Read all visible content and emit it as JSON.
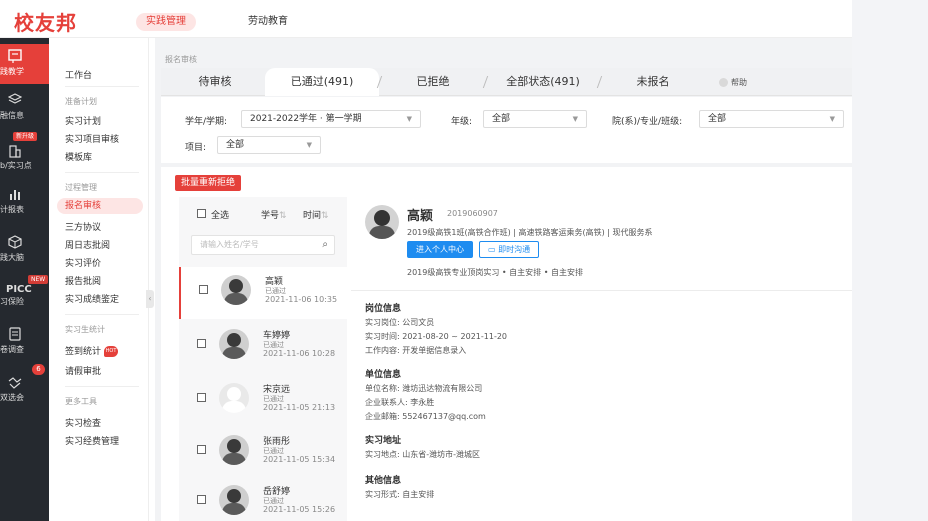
{
  "header": {
    "logo": "校友邦",
    "tabs": [
      {
        "label": "实践管理",
        "active": true
      },
      {
        "label": "劳动教育",
        "active": false
      }
    ]
  },
  "rail": {
    "items": [
      {
        "label": "践教学",
        "icon": "book-icon",
        "active": true
      },
      {
        "label": "融信息",
        "icon": "layers-icon",
        "active": false
      },
      {
        "label": "b/实习点",
        "icon": "building-icon",
        "active": false,
        "badge": "新升级"
      },
      {
        "label": "计报表",
        "icon": "bar-chart-icon",
        "active": false
      },
      {
        "label": "践大脑",
        "icon": "cube-icon",
        "active": false
      },
      {
        "label": "习保险",
        "icon": "picc-icon",
        "active": false,
        "badge": "NEW",
        "logo_text": "PICC"
      },
      {
        "label": "卷调查",
        "icon": "survey-icon",
        "active": false
      },
      {
        "label": "双选会",
        "icon": "handshake-icon",
        "active": false,
        "count": "6"
      }
    ]
  },
  "menu": {
    "workbench": "工作台",
    "group_prepare": "准备计划",
    "plan": "实习计划",
    "project_review": "实习项目审核",
    "template": "模板库",
    "group_process": "过程管理",
    "signup_review": "报名审核",
    "tripartite": "三方协议",
    "weekly": "周日志批阅",
    "evaluation": "实习评价",
    "report": "报告批阅",
    "grade": "实习成绩鉴定",
    "group_stats": "实习生统计",
    "checkin": "签到统计",
    "hot_badge": "HOT",
    "leave": "请假审批",
    "group_more": "更多工具",
    "inspection": "实习检查",
    "expense": "实习经费管理"
  },
  "main": {
    "breadcrumb": "报名审核",
    "tabs": [
      {
        "label": "待审核",
        "active": false
      },
      {
        "label": "已通过(491)",
        "active": true
      },
      {
        "label": "已拒绝",
        "active": false
      },
      {
        "label": "全部状态(491)",
        "active": false
      },
      {
        "label": "未报名",
        "active": false
      }
    ],
    "help": "帮助",
    "filters": {
      "year_label": "学年/学期:",
      "year_value": "2021-2022学年 · 第一学期",
      "grade_label": "年级:",
      "grade_value": "全部",
      "dept_label": "院(系)/专业/班级:",
      "dept_value": "全部",
      "project_label": "项目:",
      "project_value": "全部"
    },
    "batch_button": "批量重新拒绝",
    "list": {
      "select_all": "全选",
      "sort_id": "学号",
      "sort_time": "时间",
      "search_placeholder": "请输入姓名/学号",
      "students": [
        {
          "name": "高颖",
          "status": "已通过",
          "time": "2021-11-06 10:35",
          "selected": true
        },
        {
          "name": "车婷婷",
          "status": "已通过",
          "time": "2021-11-06 10:28",
          "selected": false
        },
        {
          "name": "宋京远",
          "status": "已通过",
          "time": "2021-11-05 21:13",
          "selected": false
        },
        {
          "name": "张雨彤",
          "status": "已通过",
          "time": "2021-11-05 15:34",
          "selected": false
        },
        {
          "name": "岳舒婷",
          "status": "已通过",
          "time": "2021-11-05 15:26",
          "selected": false
        }
      ]
    },
    "detail": {
      "name": "高颖",
      "student_id": "2019060907",
      "class_info": "2019级高铁1班(高铁合作班) | 高速铁路客运乘务(高铁) | 现代服务系",
      "personal_center_button": "进入个人中心",
      "chat_button": "即时沟通",
      "plan_info": "2019级高铁专业顶岗实习 • 自主安排 • 自主安排",
      "position_title": "岗位信息",
      "position_line": "实习岗位: 公司文员",
      "period_line": "实习时间: 2021-08-20 ~ 2021-11-20",
      "work_line": "工作内容: 开发单据信息录入",
      "company_title": "单位信息",
      "company_line": "单位名称: 潍坊迅达物流有限公司",
      "contact_line": "企业联系人: 李永胜",
      "email_line": "企业邮箱: 552467137@qq.com",
      "address_title": "实习地址",
      "address_line": "实习地点: 山东省-潍坊市-潍城区",
      "other_title": "其他信息",
      "form_line": "实习形式: 自主安排"
    }
  },
  "colors": {
    "brand": "#e5403a",
    "blue": "#1e8cf0",
    "rail": "#25292f"
  }
}
